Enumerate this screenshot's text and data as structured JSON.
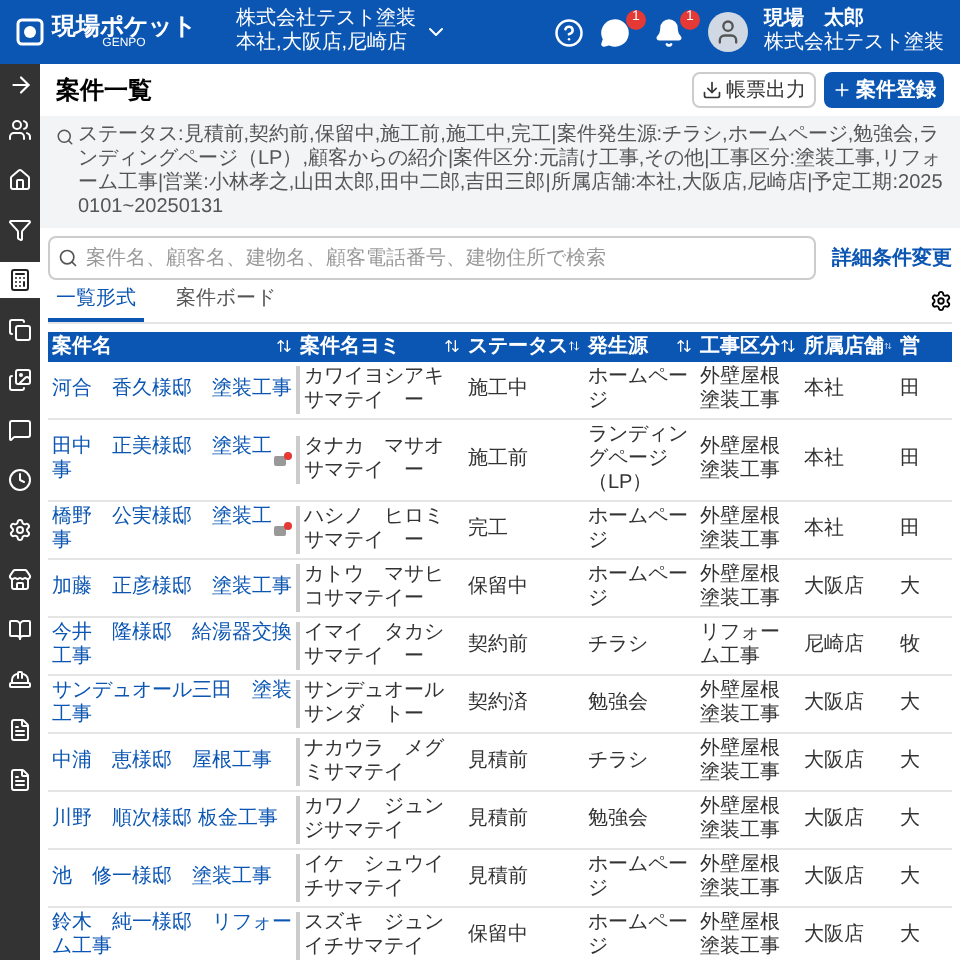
{
  "header": {
    "logo": "現場ポケット",
    "logo_sub": "GENPO",
    "company": "株式会社テスト塗装",
    "branches": "本社,大阪店,尼崎店",
    "chat_badge": "1",
    "bell_badge": "1",
    "user_name": "現場　太郎",
    "user_company": "株式会社テスト塗装"
  },
  "sidebar": {
    "items": [
      {
        "selected": false
      },
      {
        "selected": false
      },
      {
        "selected": false
      },
      {
        "selected": true
      },
      {
        "selected": false
      },
      {
        "selected": false
      },
      {
        "selected": false
      },
      {
        "selected": false
      },
      {
        "selected": false
      },
      {
        "selected": false
      },
      {
        "selected": false
      },
      {
        "selected": false
      },
      {
        "selected": false
      },
      {
        "selected": false
      }
    ]
  },
  "page": {
    "title": "案件一覧",
    "export_button": "帳票出力",
    "create_button": "案件登録"
  },
  "filter_summary": "ステータス:見積前,契約前,保留中,施工前,施工中,完工|案件発生源:チラシ,ホームページ,勉強会,ランディングページ（LP）,顧客からの紹介|案件区分:元請け工事,その他|工事区分:塗装工事,リフォーム工事|営業:小林孝之,山田太郎,田中二郎,吉田三郎|所属店舗:本社,大阪店,尼崎店|予定工期:20250101~20250131",
  "search": {
    "placeholder": "案件名、顧客名、建物名、顧客電話番号、建物住所で検索",
    "detail_link": "詳細条件変更"
  },
  "tabs": [
    {
      "label": "一覧形式",
      "selected": true
    },
    {
      "label": "案件ボード",
      "selected": false
    }
  ],
  "table": {
    "columns": [
      "案件名",
      "案件名ヨミ",
      "ステータス",
      "発生源",
      "工事区分",
      "所属店舗",
      "営"
    ],
    "rows": [
      {
        "cells": [
          "河合　香久様邸　塗装工事",
          "カワイヨシアキサマテイ　ー",
          "施工中",
          "ホームページ",
          "外壁屋根塗装工事",
          "本社",
          "田"
        ],
        "has_message": false
      },
      {
        "cells": [
          "田中　正美様邸　塗装工事",
          "タナカ　マサオサマテイ　ー",
          "施工前",
          "ランディングページ（LP）",
          "外壁屋根塗装工事",
          "本社",
          "田"
        ],
        "has_message": true
      },
      {
        "cells": [
          "橋野　公実様邸　塗装工事",
          "ハシノ　ヒロミサマテイ　ー",
          "完工",
          "ホームページ",
          "外壁屋根塗装工事",
          "本社",
          "田"
        ],
        "has_message": true
      },
      {
        "cells": [
          "加藤　正彦様邸　塗装工事",
          "カトウ　マサヒコサマテイー",
          "保留中",
          "ホームページ",
          "外壁屋根塗装工事",
          "大阪店",
          "大"
        ],
        "has_message": false
      },
      {
        "cells": [
          "今井　隆様邸　給湯器交換工事",
          "イマイ　タカシサマテイ　ー",
          "契約前",
          "チラシ",
          "リフォーム工事",
          "尼崎店",
          "牧"
        ],
        "has_message": false
      },
      {
        "cells": [
          "サンデュオール三田　塗装工事",
          "サンデュオールサンダ　トー",
          "契約済",
          "勉強会",
          "外壁屋根塗装工事",
          "大阪店",
          "大"
        ],
        "has_message": false
      },
      {
        "cells": [
          "中浦　恵様邸　屋根工事",
          "ナカウラ　メグミサマテイ",
          "見積前",
          "チラシ",
          "外壁屋根塗装工事",
          "大阪店",
          "大"
        ],
        "has_message": false
      },
      {
        "cells": [
          "川野　順次様邸 板金工事",
          "カワノ　ジュンジサマテイ",
          "見積前",
          "勉強会",
          "外壁屋根塗装工事",
          "大阪店",
          "大"
        ],
        "has_message": false
      },
      {
        "cells": [
          "池　修一様邸　塗装工事",
          "イケ　シュウイチサマテイ",
          "見積前",
          "ホームページ",
          "外壁屋根塗装工事",
          "大阪店",
          "大"
        ],
        "has_message": false
      },
      {
        "cells": [
          "鈴木　純一様邸　リフォーム工事",
          "スズキ　ジュンイチサマテイ",
          "保留中",
          "ホームページ",
          "外壁屋根塗装工事",
          "大阪店",
          "大"
        ],
        "has_message": false
      }
    ]
  }
}
